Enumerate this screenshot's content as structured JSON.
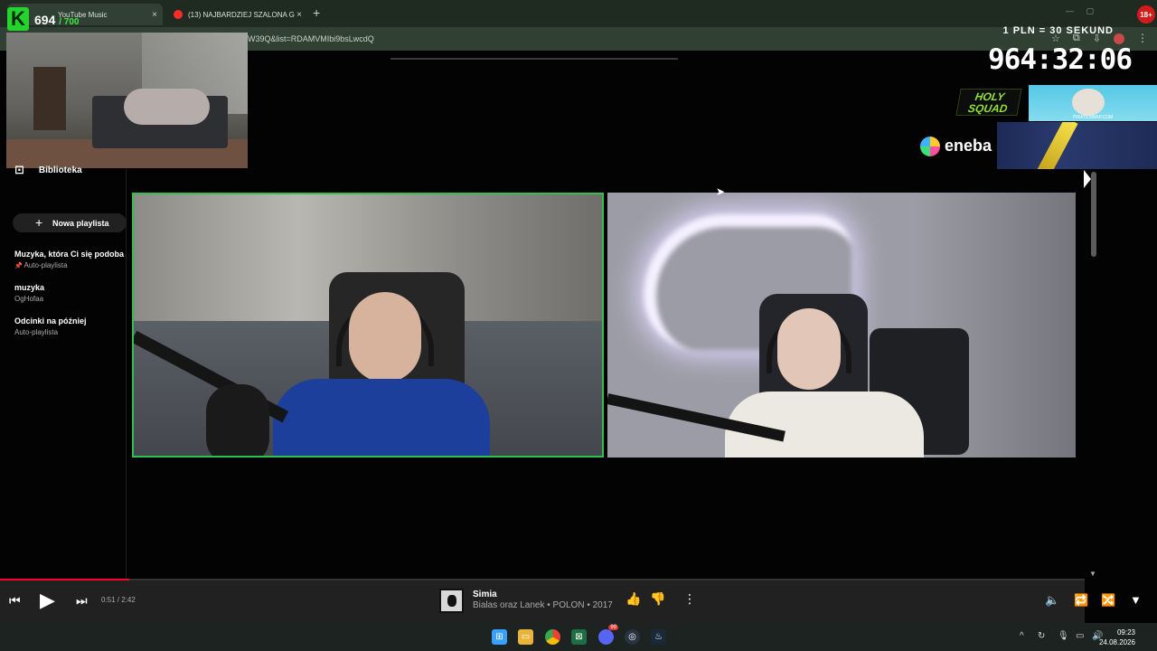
{
  "browser": {
    "tabs": [
      {
        "label": "YouTube Music",
        "active": true
      },
      {
        "label": "(13) NAJBARDZIEJ SZALONA G...",
        "active": false
      }
    ],
    "new_tab_symbol": "+",
    "close_symbol": "×",
    "url": "W39Q&list=RDAMVMIbi9bsLwcdQ",
    "age_badge": "18+"
  },
  "stream_overlay": {
    "kick_logo": "K",
    "viewer_count": "694",
    "viewer_max": "/ 700",
    "timer_caption": "1 PLN = 30 SEKUND",
    "timer_value": "964:32:06",
    "sponsor_holy_squad": "HOLY SQUAD",
    "sponsor_pirate": "PIRATESWAP.COM",
    "sponsor_eneba": "eneba"
  },
  "sidebar": {
    "library_label": "Biblioteka",
    "new_playlist_label": "Nowa playlista",
    "playlists": [
      {
        "title": "Muzyka, która Ci się podoba",
        "subtitle": "Auto-playlista",
        "pinned": true
      },
      {
        "title": "muzyka",
        "subtitle": "OgHofaa",
        "pinned": false
      },
      {
        "title": "Odcinki na później",
        "subtitle": "Auto-playlista",
        "pinned": false
      }
    ]
  },
  "player": {
    "time": "0:51 / 2:42",
    "progress": 0.314,
    "track_title": "Simia",
    "track_subtitle": "Bialas oraz Lanek • POLON • 2017",
    "accent_color": "#ff0033"
  },
  "taskbar": {
    "time": "09:23",
    "date": "24.08.2026",
    "discord_badge": "99"
  }
}
